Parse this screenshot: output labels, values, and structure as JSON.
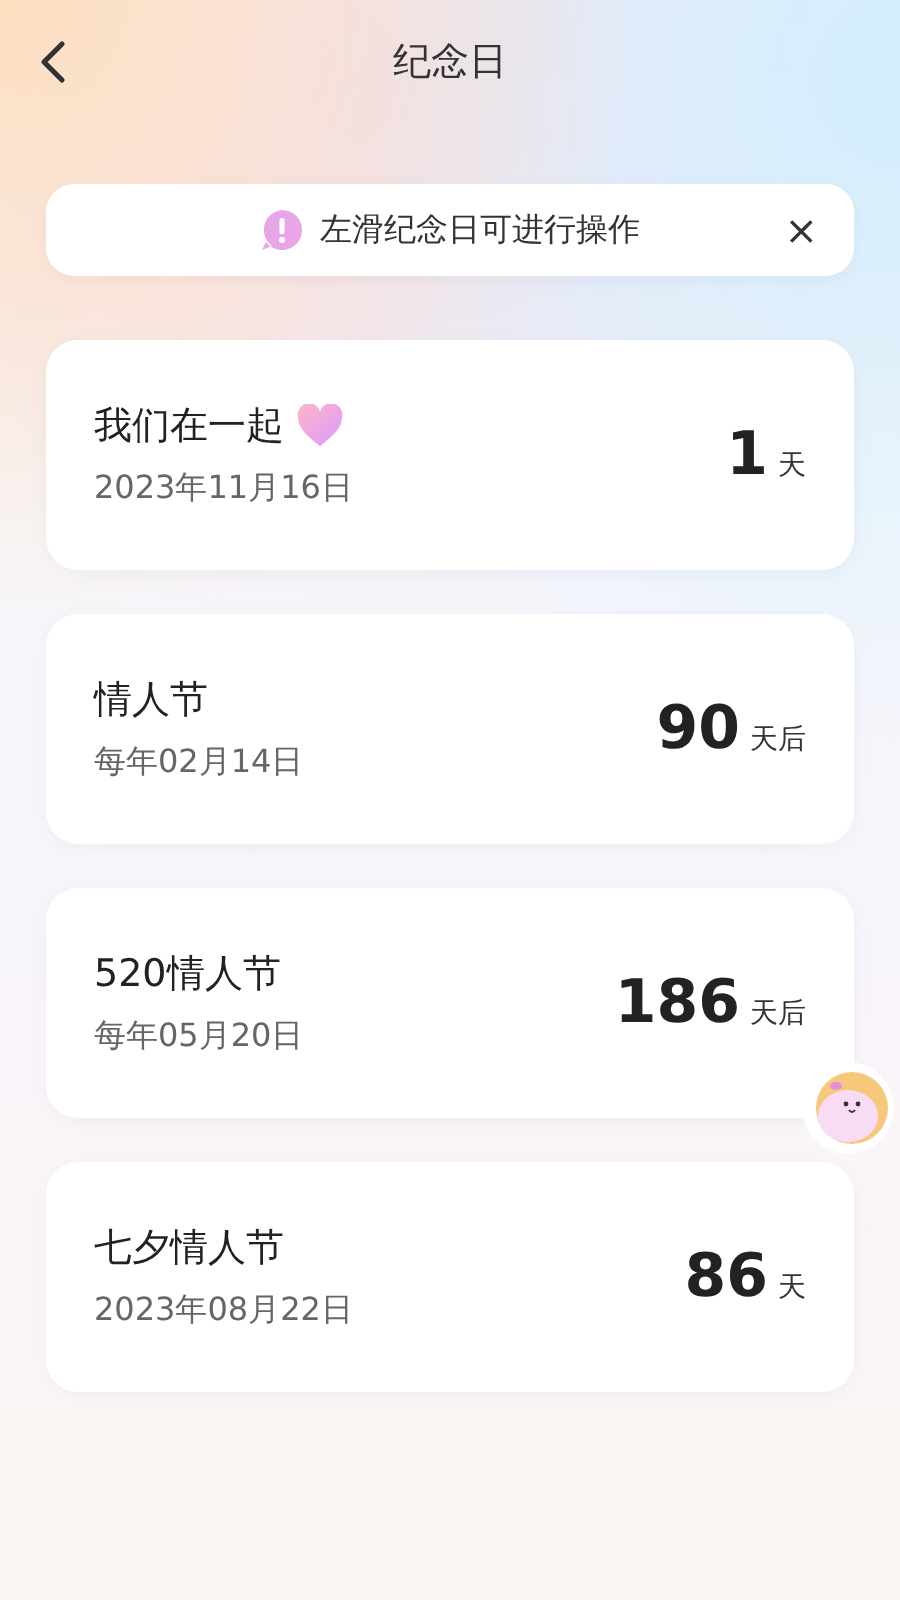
{
  "header": {
    "title": "纪念日"
  },
  "tip": {
    "text": "左滑纪念日可进行操作",
    "close": "×"
  },
  "anniversaries": [
    {
      "name": "我们在一起",
      "heart": true,
      "date": "2023年11月16日",
      "count": "1",
      "unit": "天"
    },
    {
      "name": "情人节",
      "heart": false,
      "date": "每年02月14日",
      "count": "90",
      "unit": "天后"
    },
    {
      "name": "520情人节",
      "heart": false,
      "date": "每年05月20日",
      "count": "186",
      "unit": "天后"
    },
    {
      "name": "七夕情人节",
      "heart": false,
      "date": "2023年08月22日",
      "count": "86",
      "unit": "天"
    }
  ]
}
